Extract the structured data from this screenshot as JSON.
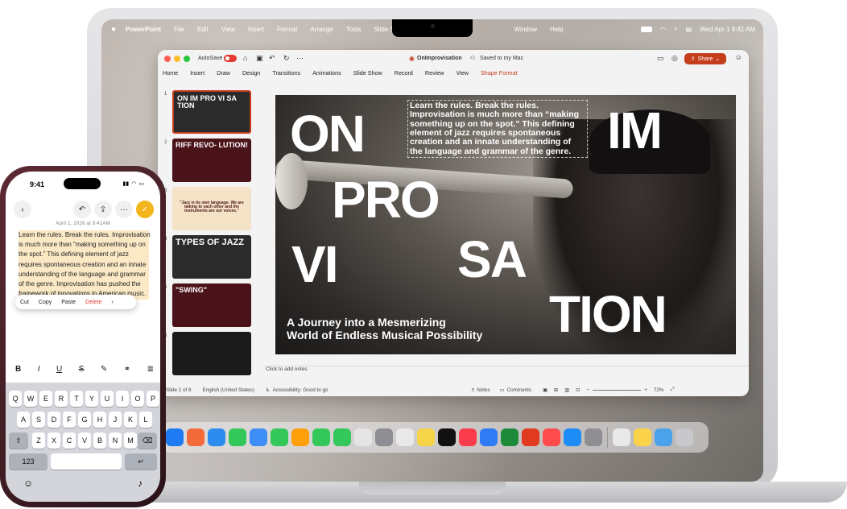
{
  "mac": {
    "menubar": {
      "app": "PowerPoint",
      "items": [
        "File",
        "Edit",
        "View",
        "Insert",
        "Format",
        "Arrange",
        "Tools",
        "Slide Show",
        "Window",
        "Help"
      ],
      "clock": "Wed Apr 1  9:41 AM"
    },
    "ppt": {
      "autosave_label": "AutoSave",
      "doc_title": "OnImprovisation",
      "saved_status": "Saved to my Mac",
      "share_label": "Share",
      "tabs": [
        "Home",
        "Insert",
        "Draw",
        "Design",
        "Transitions",
        "Animations",
        "Slide Show",
        "Record",
        "Review",
        "View",
        "Shape Format"
      ],
      "thumbnails": [
        {
          "num": "1",
          "text": "ON IM PRO VI SA TION"
        },
        {
          "num": "2",
          "text": "RIFF REVO- LUTION!"
        },
        {
          "num": "3",
          "text": "\"Jazz is its own language. We are talking to each other and the instruments are our voices.\""
        },
        {
          "num": "4",
          "text": "TYPES OF JAZZ"
        },
        {
          "num": "5",
          "text": "\"SWING\""
        },
        {
          "num": "6",
          "text": ""
        }
      ],
      "slide": {
        "words": [
          "ON",
          "IM",
          "PRO",
          "VI",
          "SA",
          "TION"
        ],
        "quote": "Learn the rules. Break the rules. Improvisation is much more than “making something up on the spot.” This defining element of jazz requires spontaneous creation and an innate understanding of the language and grammar of the genre.",
        "subtitle_line1": "A Journey into a Mesmerizing",
        "subtitle_line2": "World of Endless Musical Possibility"
      },
      "notes_placeholder": "Click to add notes",
      "status": {
        "slide_of": "Slide 1 of 8",
        "language": "English (United States)",
        "accessibility": "Accessibility: Good to go",
        "notes": "Notes",
        "comments": "Comments",
        "zoom": "72%"
      }
    },
    "dock_colors": [
      "#1f7bf2",
      "#f36b3a",
      "#2d8cf0",
      "#34c759",
      "#3d8ff7",
      "#34c759",
      "#ff9f0a",
      "#34c759",
      "#34c759",
      "#e5e5e5",
      "#8e8e93",
      "#e9e9e9",
      "#f5d547",
      "#111111",
      "#fa3c4c",
      "#2f7bf6",
      "#1d8a3a",
      "#e03a1f",
      "#ff4b4b",
      "#1e8cf7",
      "#8e8e93",
      "#e9e9e9",
      "#fbd34a",
      "#4aa3ea",
      "#c7c7cc"
    ]
  },
  "iphone": {
    "time": "9:41",
    "date": "April 1, 2026 at 9:41AM",
    "note_text": "Learn the rules. Break the rules. Improvisation is much more than “making something up on the spot.” This defining element of jazz requires spontaneous creation and an innate understanding of the language and grammar of the genre. Improvisation has pushed the framework of innovations in American music.",
    "edit_menu": [
      "Cut",
      "Copy",
      "Paste",
      "Delete"
    ],
    "keyboard": {
      "row1": [
        "Q",
        "W",
        "E",
        "R",
        "T",
        "Y",
        "U",
        "I",
        "O",
        "P"
      ],
      "row2": [
        "A",
        "S",
        "D",
        "F",
        "G",
        "H",
        "J",
        "K",
        "L"
      ],
      "row3": [
        "Z",
        "X",
        "C",
        "V",
        "B",
        "N",
        "M"
      ],
      "numbers_key": "123"
    },
    "accent": "#f2b51c"
  }
}
